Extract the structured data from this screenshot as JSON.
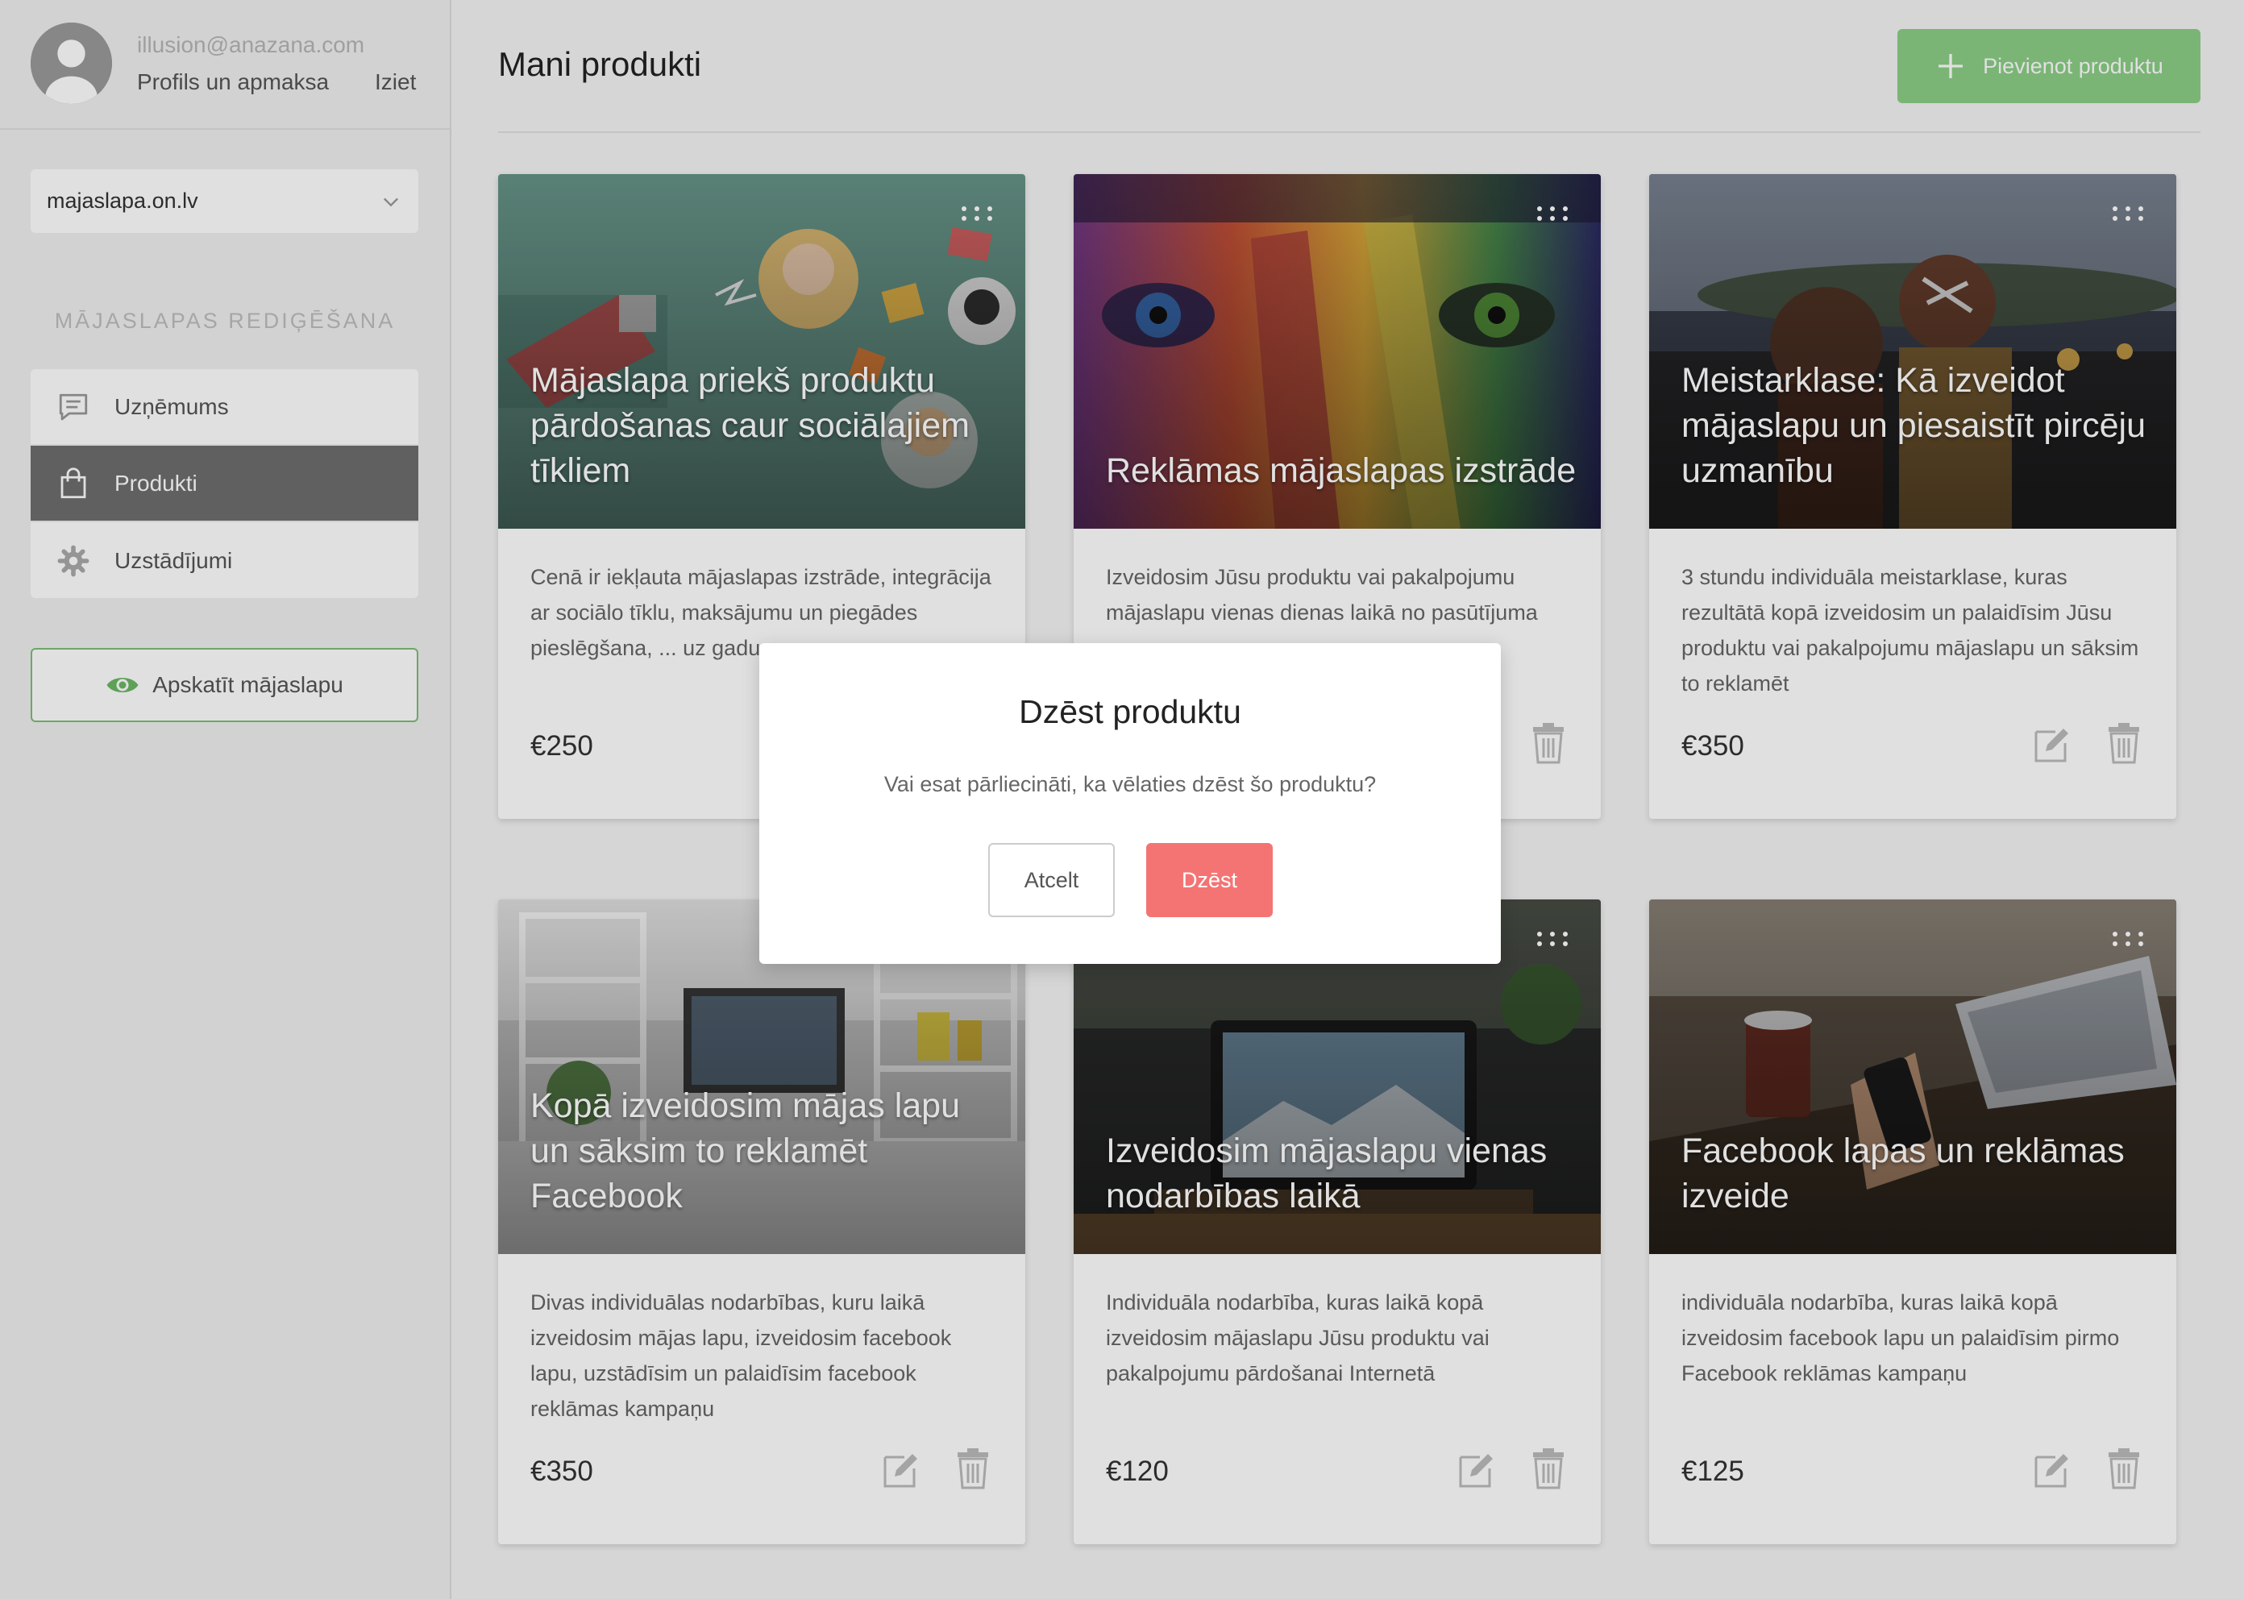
{
  "colors": {
    "accent_green": "#8bcf86",
    "active_menu": "#6e6e6e",
    "danger": "#f47474"
  },
  "profile": {
    "email": "illusion@anazana.com",
    "profile_link": "Profils un apmaksa",
    "logout": "Iziet"
  },
  "site_select": {
    "value": "majaslapa.on.lv"
  },
  "sidebar": {
    "section_title": "MĀJASLAPAS REDIĢĒŠANA",
    "items": [
      {
        "label": "Uzņēmums",
        "icon": "message-icon"
      },
      {
        "label": "Produkti",
        "icon": "bag-icon",
        "active": true
      },
      {
        "label": "Uzstādījumi",
        "icon": "gear-icon"
      }
    ],
    "view_site": "Apskatīt mājaslapu"
  },
  "main": {
    "title": "Mani produkti",
    "add_button": "Pievienot produktu"
  },
  "products": [
    {
      "title": "Mājaslapa priekš produktu pārdošanas caur sociālajiem tīkliem",
      "description": "Cenā ir iekļauta mājaslapas izstrāde, integrācija ar sociālo tīklu, maksājumu un piegādes pieslēgšana, ...",
      "visible_description_tail": "uz gadu.",
      "price": "€250"
    },
    {
      "title": "Reklāmas mājaslapas izstrāde",
      "description": "Izveidosim Jūsu produktu vai pakalpojumu mājaslapu vienas dienas laikā no pasūtījuma",
      "price": ""
    },
    {
      "title": "Meistarklase: Kā izveidot mājaslapu un piesaistīt pircēju uzmanību",
      "description": "3 stundu individuāla meistarklase, kuras rezultātā kopā izveidosim un palaidīsim Jūsu produktu vai pakalpojumu mājaslapu un sāksim to reklamēt",
      "price": "€350"
    },
    {
      "title": "Kopā izveidosim mājas lapu un sāksim to reklamēt Facebook",
      "description": "Divas individuālas nodarbības, kuru laikā izveidosim mājas lapu, izveidosim facebook lapu, uzstādīsim un palaidīsim facebook reklāmas kampaņu",
      "price": "€350"
    },
    {
      "title": "Izveidosim mājaslapu vienas nodarbības laikā",
      "description": "Individuāla nodarbība, kuras laikā kopā izveidosim mājaslapu Jūsu produktu vai pakalpojumu pārdošanai Internetā",
      "price": "€120"
    },
    {
      "title": "Facebook lapas un reklāmas izveide",
      "description": "individuāla nodarbība, kuras laikā kopā izveidosim facebook lapu un palaidīsim pirmo Facebook reklāmas kampaņu",
      "price": "€125"
    }
  ],
  "modal": {
    "title": "Dzēst produktu",
    "text": "Vai esat pārliecināti, ka vēlaties dzēst šo produktu?",
    "cancel": "Atcelt",
    "delete": "Dzēst"
  }
}
